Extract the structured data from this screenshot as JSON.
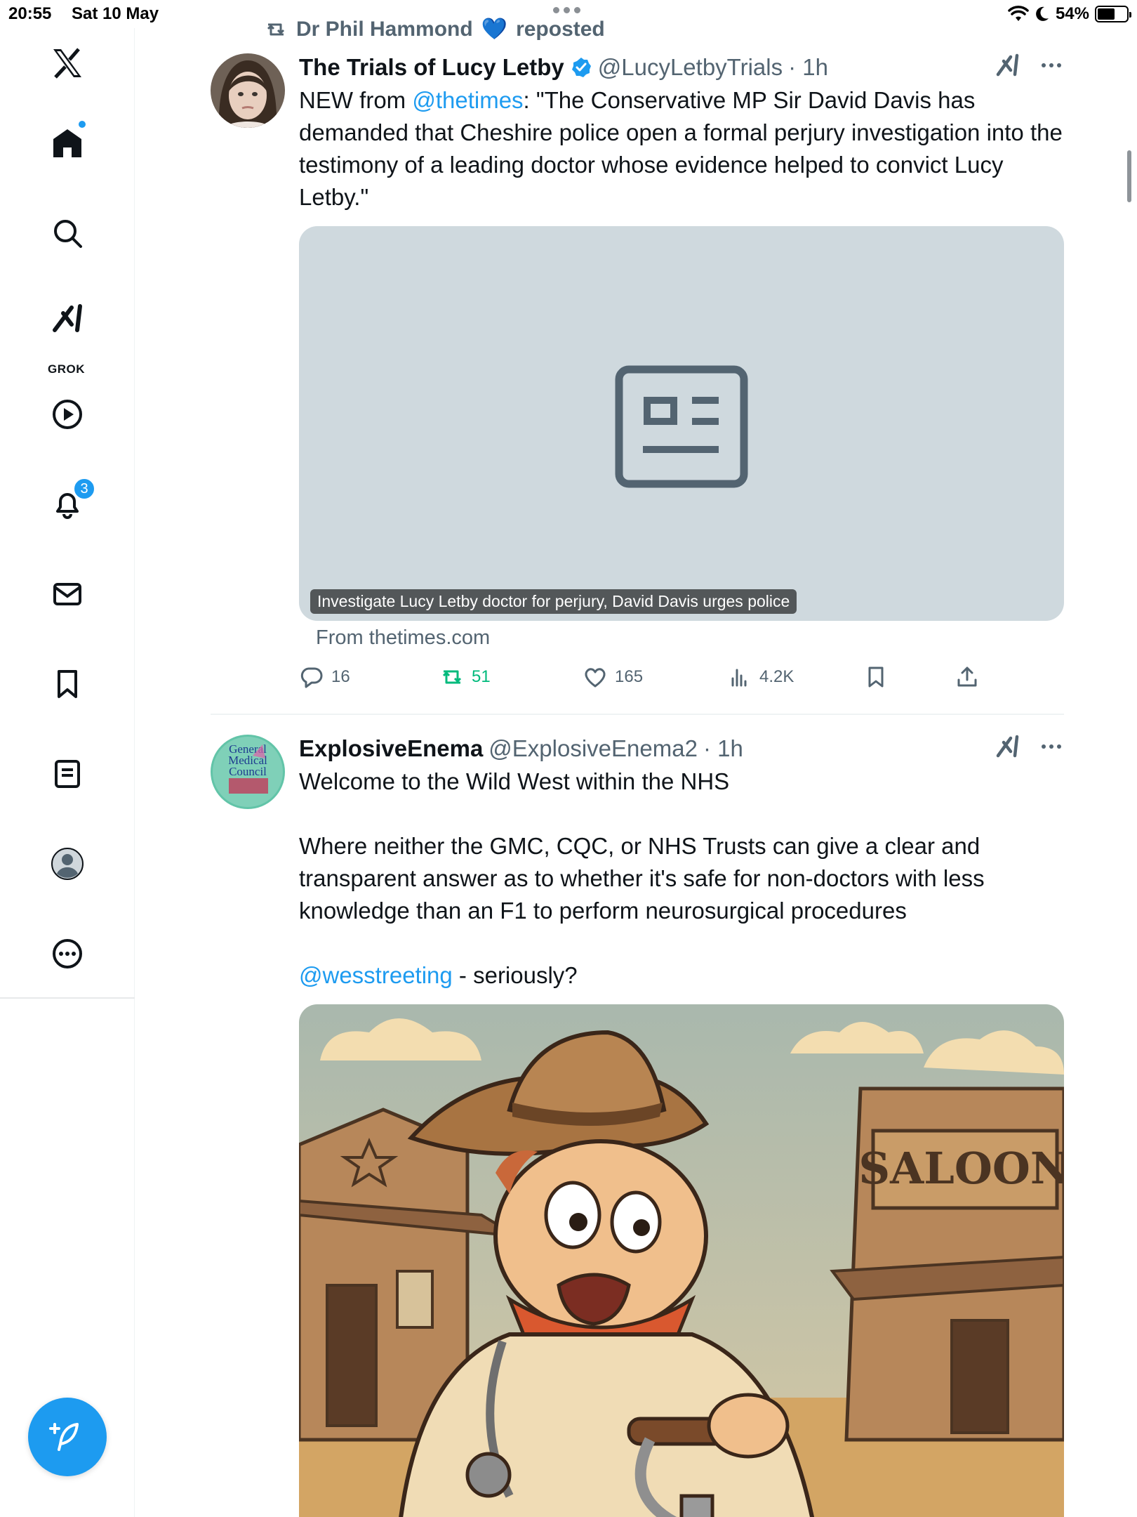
{
  "status_bar": {
    "time": "20:55",
    "date": "Sat 10 May",
    "battery": "54%"
  },
  "sidebar": {
    "items": [
      {
        "name": "x-logo",
        "icon": "x-logo-icon"
      },
      {
        "name": "home",
        "icon": "home-icon",
        "has_dot": true
      },
      {
        "name": "explore",
        "icon": "search-icon"
      },
      {
        "name": "grok",
        "icon": "grok-icon",
        "label": "GROK"
      },
      {
        "name": "video",
        "icon": "play-icon"
      },
      {
        "name": "notifications",
        "icon": "bell-icon",
        "badge": "3"
      },
      {
        "name": "messages",
        "icon": "mail-icon"
      },
      {
        "name": "bookmarks",
        "icon": "bookmark-icon"
      },
      {
        "name": "lists",
        "icon": "list-icon"
      },
      {
        "name": "profile",
        "icon": "profile-icon"
      },
      {
        "name": "more",
        "icon": "more-circle-icon"
      }
    ],
    "compose_icon": "compose-icon"
  },
  "repost": {
    "user": "Dr Phil Hammond",
    "emoji": "💙",
    "label": "reposted"
  },
  "tweets": [
    {
      "name": "The Trials of Lucy Letby",
      "verified": true,
      "handle": "@LucyLetbyTrials",
      "time": "· 1h",
      "text_prefix": "NEW from ",
      "mention": "@thetimes",
      "text_rest": ": \"The Conservative MP Sir David Davis has demanded that Cheshire police open a formal perjury investigation into the testimony of a leading doctor whose evidence helped to convict Lucy Letby.\"",
      "card": {
        "caption": "Investigate Lucy Letby doctor for perjury, David Davis urges police",
        "source": "From thetimes.com"
      },
      "stats": {
        "replies": "16",
        "reposts": "51",
        "likes": "165",
        "views": "4.2K"
      }
    },
    {
      "name": "ExplosiveEnema",
      "verified": false,
      "handle": "@ExplosiveEnema2",
      "time": "· 1h",
      "line1": "Welcome to the Wild West within the NHS",
      "line2": "Where neither the GMC, CQC, or NHS Trusts can give a clear and transparent answer as to whether it's safe for non-doctors with less knowledge than an F1 to perform neurosurgical procedures",
      "mention": "@wesstreeting",
      "line3_rest": " - seriously?",
      "avatar_text": [
        "General",
        "Medical",
        "Council"
      ],
      "image_text": "SALOON"
    }
  ],
  "colors": {
    "accent": "#1d9bf0",
    "text": "#0f1419",
    "secondary": "#536471",
    "repost_green": "#00ba7c",
    "card_bg": "#cfd9de"
  }
}
